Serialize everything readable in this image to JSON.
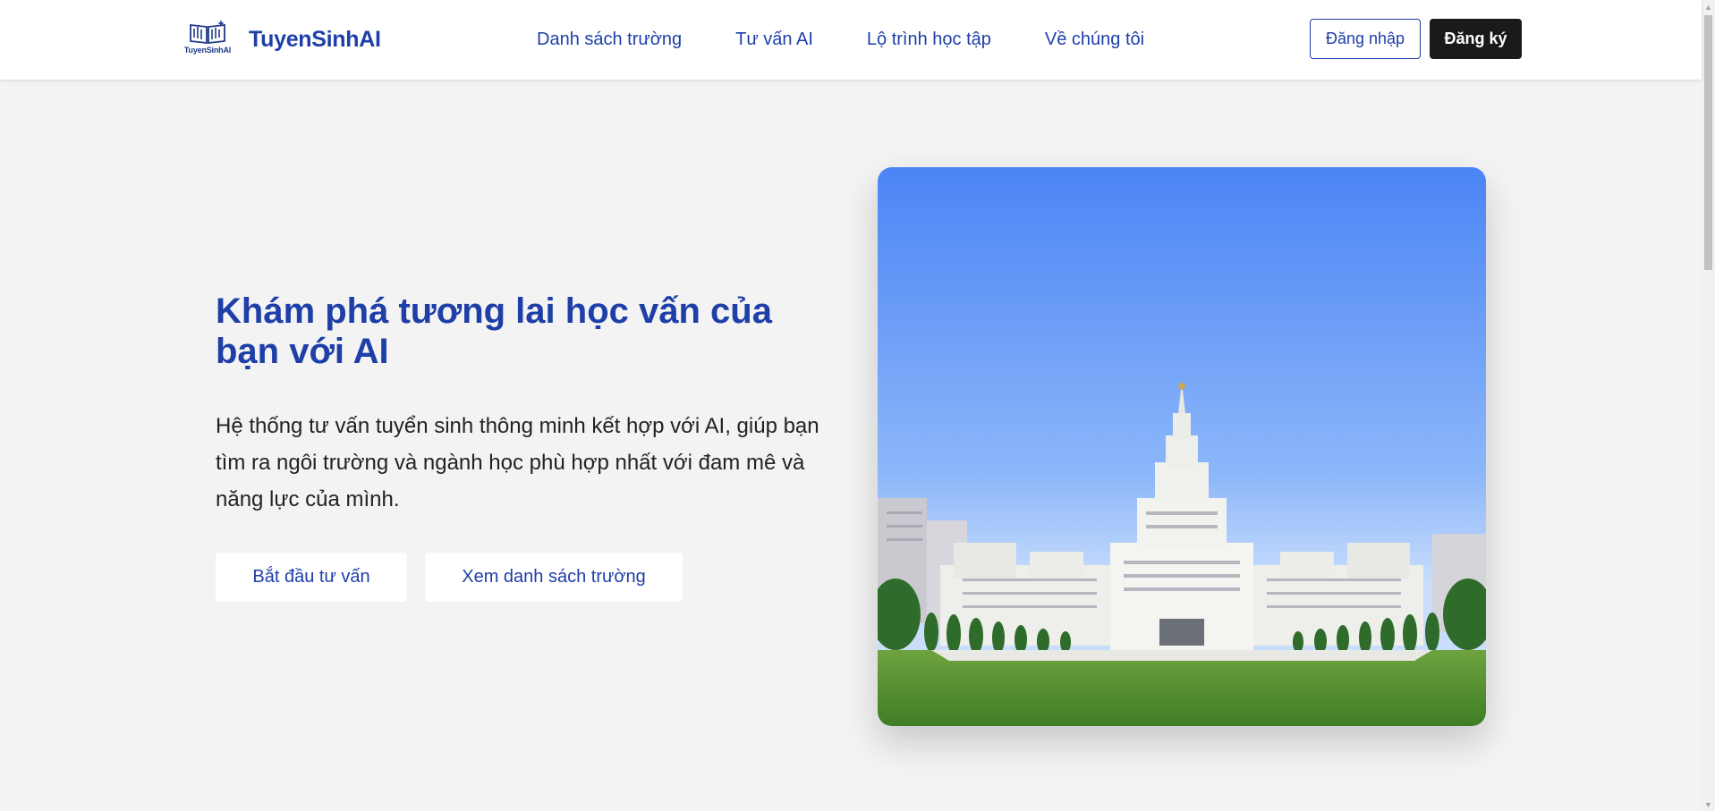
{
  "header": {
    "logo_text": "TuyenSinhAI",
    "brand_name": "TuyenSinhAI",
    "nav": [
      {
        "label": "Danh sách trường"
      },
      {
        "label": "Tư vấn AI"
      },
      {
        "label": "Lộ trình học tập"
      },
      {
        "label": "Về chúng tôi"
      }
    ],
    "login_label": "Đăng nhập",
    "register_label": "Đăng ký"
  },
  "hero": {
    "title": "Khám phá tương lai học vấn của bạn với AI",
    "description": "Hệ thống tư vấn tuyển sinh thông minh kết hợp với AI, giúp bạn tìm ra ngôi trường và ngành học phù hợp nhất với đam mê và năng lực của mình.",
    "cta_primary": "Bắt đầu tư vấn",
    "cta_secondary": "Xem danh sách trường"
  },
  "colors": {
    "brand": "#1e3fa8",
    "background": "#f3f3f3",
    "register_bg": "#1a1a1a"
  },
  "icons": [
    "logo-book-icon",
    "scroll-up-icon",
    "scroll-down-icon"
  ]
}
